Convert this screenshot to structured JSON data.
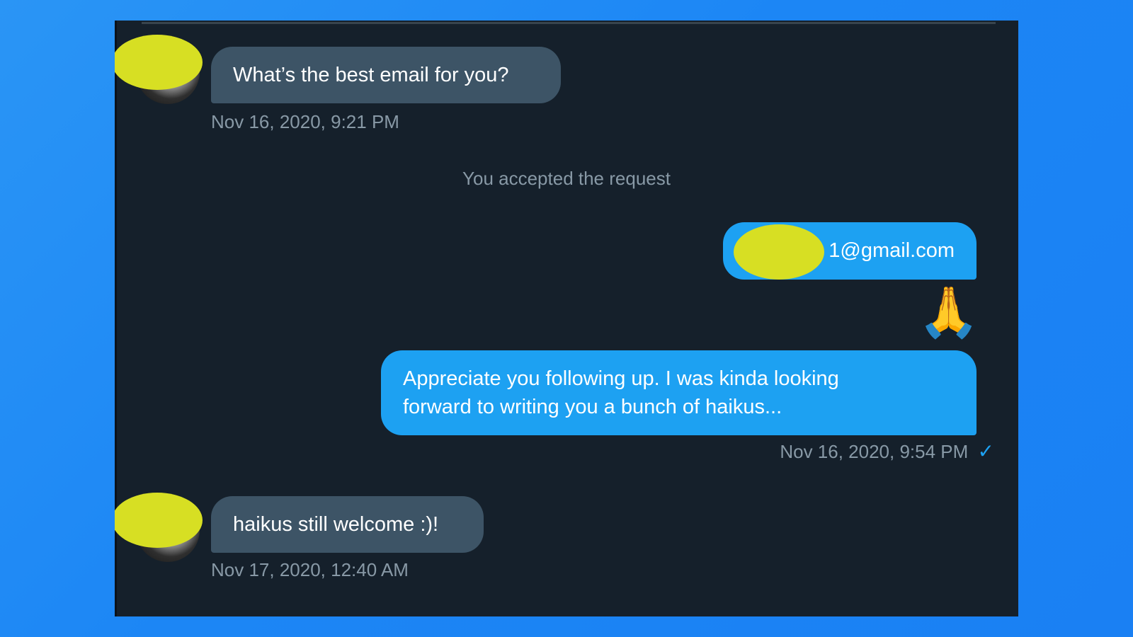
{
  "conversation": {
    "messages": [
      {
        "direction": "incoming",
        "text": "What’s the best email for you?",
        "timestamp": "Nov 16, 2020, 9:21 PM"
      },
      {
        "direction": "system",
        "text": "You accepted the request"
      },
      {
        "direction": "outgoing",
        "text": "1@gmail.com"
      },
      {
        "direction": "outgoing",
        "text": "🙏"
      },
      {
        "direction": "outgoing",
        "line1": "Appreciate you following up. I was kinda looking",
        "line2": "forward to writing you a bunch of haikus...",
        "timestamp": "Nov 16, 2020, 9:54 PM",
        "status_icon": "✓"
      },
      {
        "direction": "incoming",
        "text": "haikus still welcome :)!",
        "timestamp": "Nov 17, 2020, 12:40 AM"
      }
    ]
  },
  "colors": {
    "background_gradient": "#1c86f5",
    "panel": "#15202b",
    "incoming_bubble": "#3d5466",
    "outgoing_bubble": "#1da1f2",
    "meta_text": "#8899a6",
    "redaction": "#d7df23"
  },
  "icons": {
    "read_receipt": "check-icon",
    "emoji": "folded-hands-emoji"
  }
}
